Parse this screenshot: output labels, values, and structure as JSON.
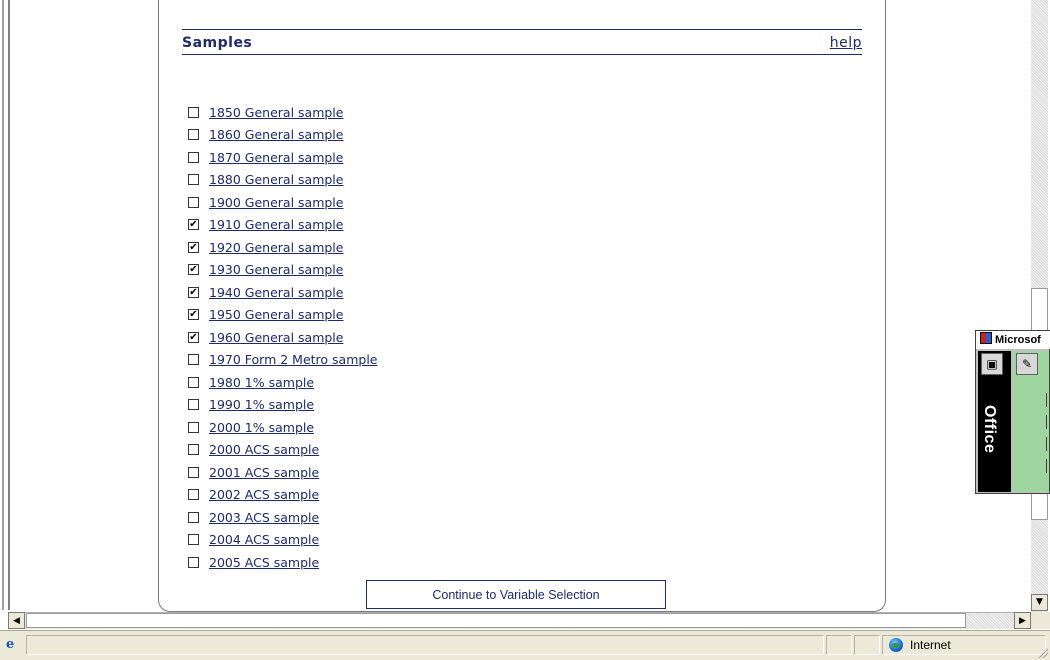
{
  "panel": {
    "title": "Samples",
    "help_label": "help"
  },
  "samples": [
    {
      "label": "1850 General sample",
      "checked": false
    },
    {
      "label": "1860 General sample",
      "checked": false
    },
    {
      "label": "1870 General sample",
      "checked": false
    },
    {
      "label": "1880 General sample",
      "checked": false
    },
    {
      "label": "1900 General sample",
      "checked": false
    },
    {
      "label": "1910 General sample",
      "checked": true
    },
    {
      "label": "1920 General sample",
      "checked": true
    },
    {
      "label": "1930 General sample",
      "checked": true
    },
    {
      "label": "1940 General sample",
      "checked": true
    },
    {
      "label": "1950 General sample",
      "checked": true
    },
    {
      "label": "1960 General sample",
      "checked": true
    },
    {
      "label": "1970 Form 2 Metro sample",
      "checked": false
    },
    {
      "label": "1980 1% sample",
      "checked": false
    },
    {
      "label": "1990 1% sample",
      "checked": false
    },
    {
      "label": "2000 1% sample",
      "checked": false
    },
    {
      "label": "2000 ACS sample",
      "checked": false
    },
    {
      "label": "2001 ACS sample",
      "checked": false
    },
    {
      "label": "2002 ACS sample",
      "checked": false
    },
    {
      "label": "2003 ACS sample",
      "checked": false
    },
    {
      "label": "2004 ACS sample",
      "checked": false
    },
    {
      "label": "2005 ACS sample",
      "checked": false
    }
  ],
  "continue_button": "Continue to Variable Selection",
  "statusbar": {
    "zone_label": "Internet"
  },
  "office_bar": {
    "title": "Microsof",
    "side_label": "Office"
  },
  "colors": {
    "link": "#1e2a6e",
    "office_green": "#9fd69f"
  }
}
